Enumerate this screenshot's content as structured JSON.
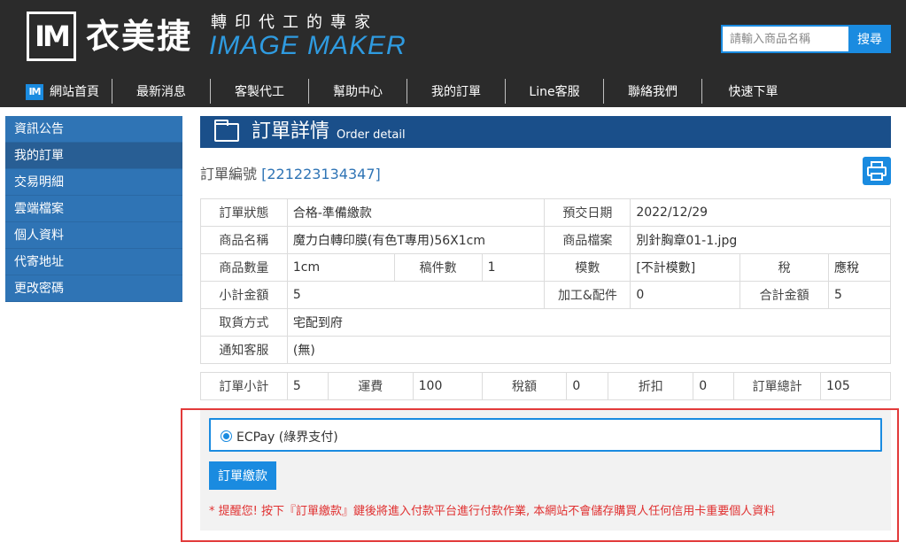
{
  "brand": {
    "logo_mark": "IM",
    "name_cn": "衣美捷",
    "slogan": "轉印代工的專家",
    "name_en": "IMAGE MAKER"
  },
  "search": {
    "placeholder": "請輸入商品名稱",
    "button": "搜尋"
  },
  "nav": {
    "home_icon_text": "IM",
    "items": [
      "網站首頁",
      "最新消息",
      "客製代工",
      "幫助中心",
      "我的訂單",
      "Line客服",
      "聯絡我們",
      "快速下單"
    ]
  },
  "sidebar": {
    "items": [
      "資訊公告",
      "我的訂單",
      "交易明細",
      "雲端檔案",
      "個人資料",
      "代寄地址",
      "更改密碼"
    ],
    "active": "我的訂單"
  },
  "page": {
    "title": "訂單詳情",
    "subtitle": "Order detail",
    "order_label": "訂單編號",
    "order_number": "[221223134347]"
  },
  "detail": {
    "status_label": "訂單狀態",
    "status": "合格-準備繳款",
    "due_label": "預交日期",
    "due": "2022/12/29",
    "product_label": "商品名稱",
    "product": "魔力白轉印膜(有色T專用)56X1cm",
    "file_label": "商品檔案",
    "file": "別針胸章01-1.jpg",
    "qty_label": "商品數量",
    "qty": "1cm",
    "pieces_label": "稿件數",
    "pieces": "1",
    "mold_label": "模數",
    "mold": "[不計模數]",
    "tax_label": "稅",
    "tax": "應稅",
    "subtotal_label": "小計金額",
    "subtotal": "5",
    "process_label": "加工&配件",
    "process": "0",
    "total_label": "合計金額",
    "total": "5",
    "pickup_label": "取貨方式",
    "pickup": "宅配到府",
    "notify_label": "通知客服",
    "notify": "(無)"
  },
  "summary": {
    "subtotal_label": "訂單小計",
    "subtotal": "5",
    "shipping_label": "運費",
    "shipping": "100",
    "tax_label": "稅額",
    "tax": "0",
    "discount_label": "折扣",
    "discount": "0",
    "total_label": "訂單總計",
    "total": "105"
  },
  "payment": {
    "option": "ECPay (綠界支付)",
    "button": "訂單繳款",
    "note": "* 提醒您! 按下『訂單繳款』鍵後將進入付款平台進行付款作業, 本網站不會儲存購買人任何信用卡重要個人資料"
  },
  "colors": {
    "accent": "#1a8be0",
    "header_bg": "#2b2b2b",
    "sidebar_bg": "#2f74b5",
    "title_bg": "#1a4f8a",
    "alert": "#e23a3a"
  }
}
